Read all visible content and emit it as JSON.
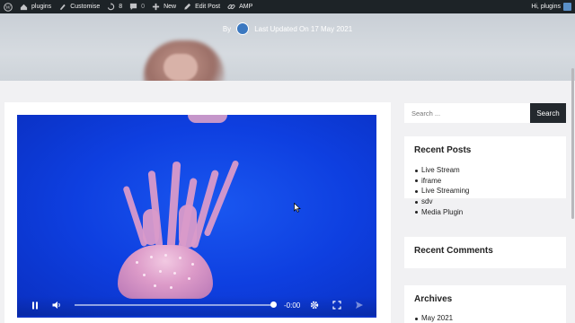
{
  "admin_bar": {
    "site_name": "plugins",
    "customise": "Customise",
    "updates_count": "8",
    "comments_count": "0",
    "new_label": "New",
    "edit_post": "Edit Post",
    "amp": "AMP",
    "greeting": "Hi, plugins"
  },
  "header": {
    "by_label": "By",
    "last_updated": "Last Updated On 17 May 2021"
  },
  "video": {
    "time_remaining": "-0:00",
    "progress_fraction": 1.0
  },
  "sidebar": {
    "search_placeholder": "Search ...",
    "search_button": "Search",
    "recent_posts_title": "Recent Posts",
    "recent_posts": [
      "Live Stream",
      "iframe",
      "Live Streaming",
      "sdv",
      "Media Plugin"
    ],
    "recent_comments_title": "Recent Comments",
    "archives_title": "Archives",
    "archives": [
      "May 2021"
    ]
  },
  "colors": {
    "admin_bar_bg": "#1d2327",
    "video_blue": "#0e3fe0",
    "search_button_bg": "#23282d",
    "page_bg": "#f1f1f3"
  }
}
